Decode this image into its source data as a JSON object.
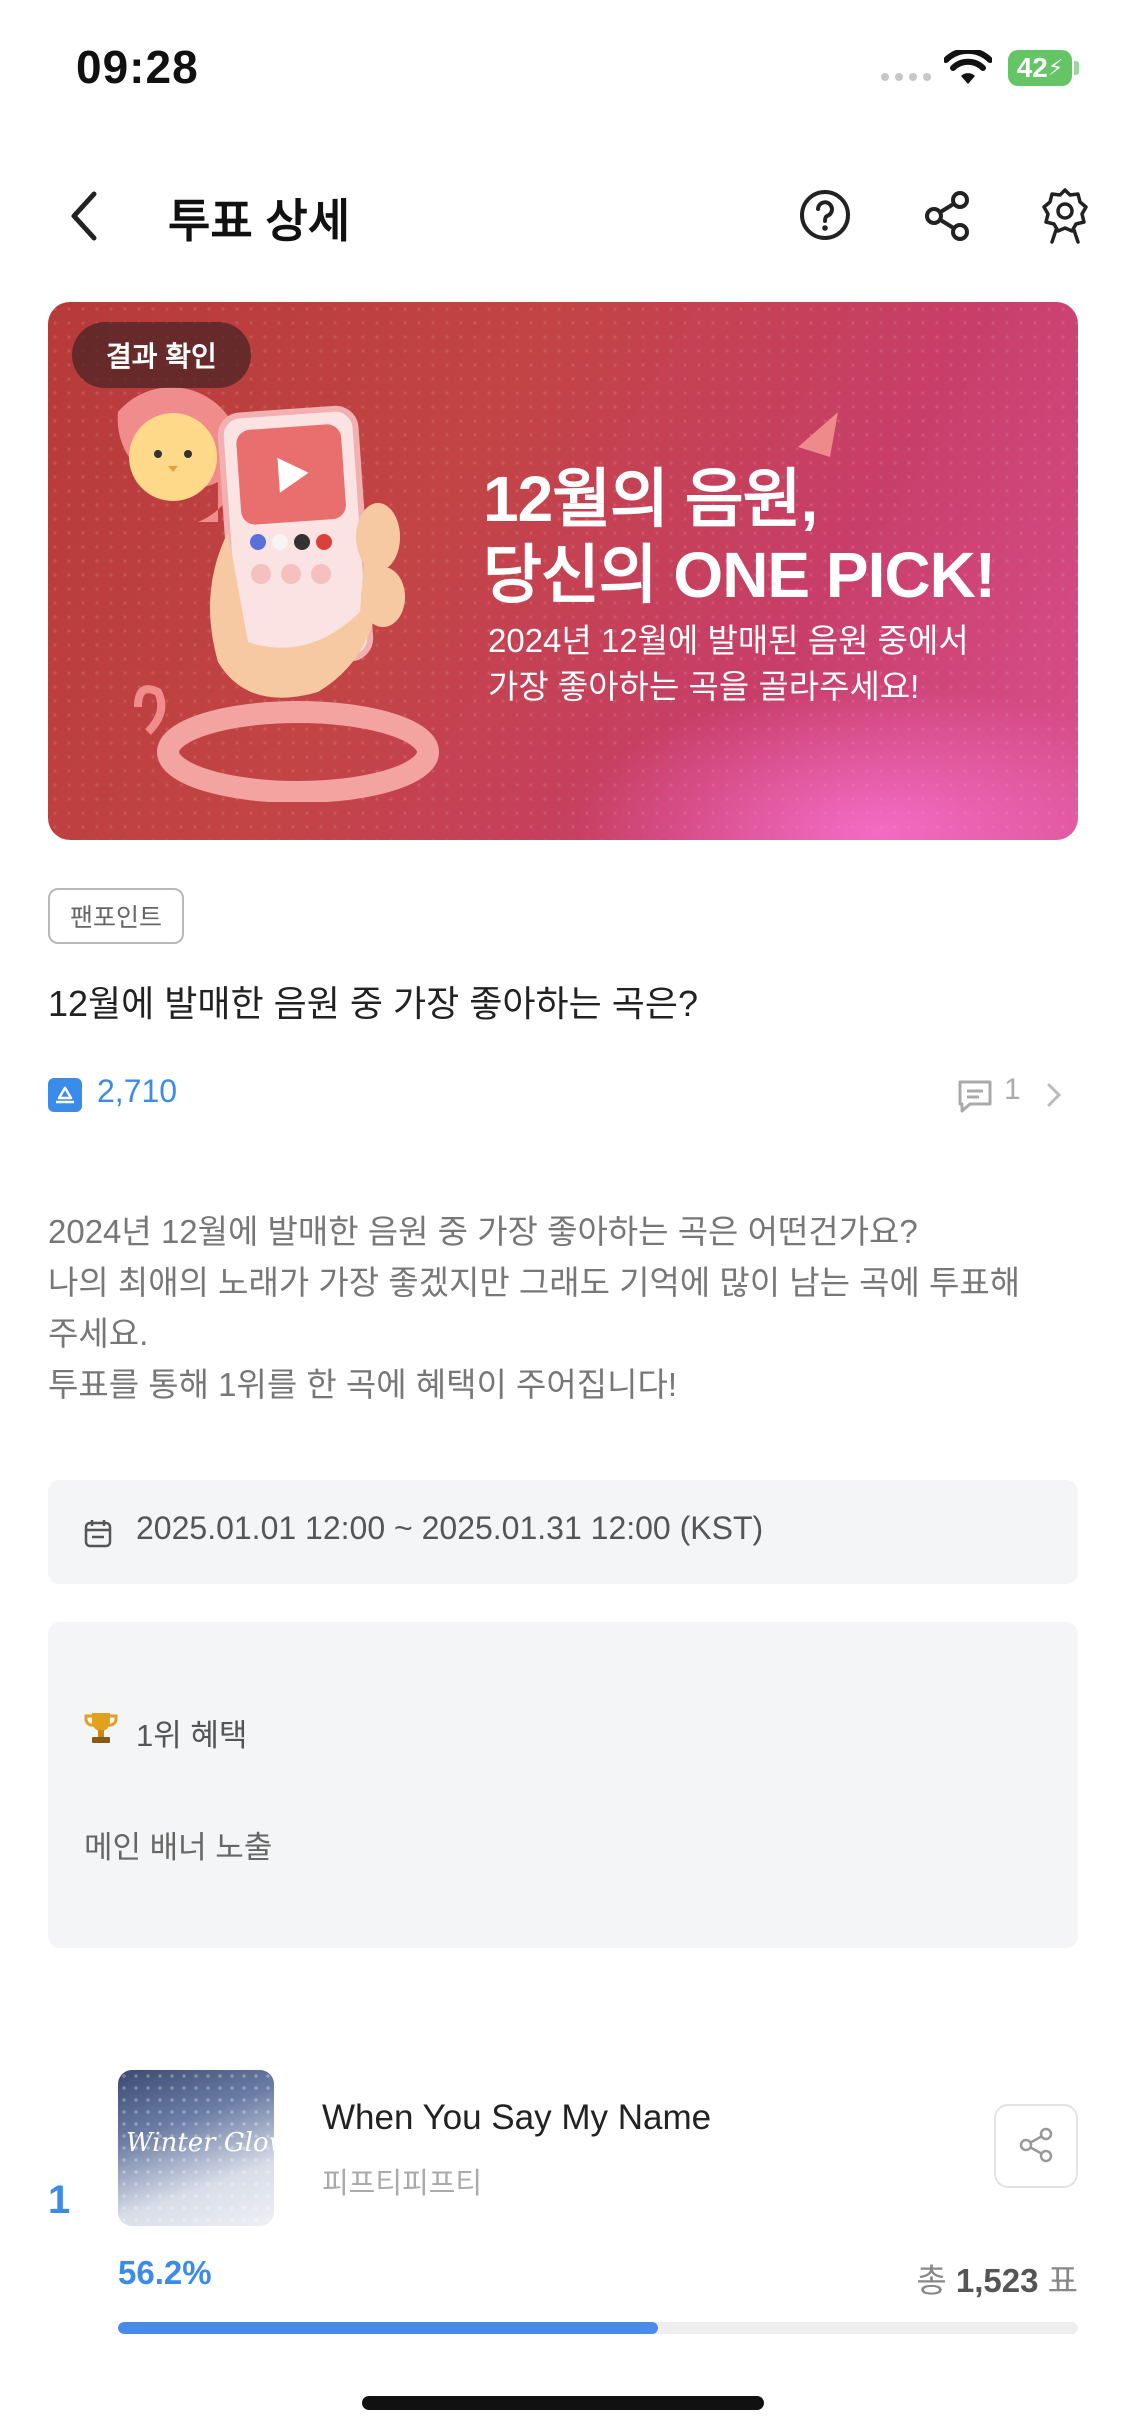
{
  "status_bar": {
    "time": "09:28",
    "battery": "42"
  },
  "header": {
    "title": "투표 상세",
    "icons": [
      "back-icon",
      "help-icon",
      "share-icon",
      "settings-badge-icon"
    ]
  },
  "banner": {
    "badge": "결과 확인",
    "headline_1": "12월의 음원,",
    "headline_2": "당신의 ONE PICK!",
    "sub_1": "2024년 12월에 발매된 음원 중에서",
    "sub_2": "가장 좋아하는 곡을 골라주세요!",
    "colors": {
      "base": "#c24444",
      "accent": "#d9508e"
    }
  },
  "vote": {
    "category": "팬포인트",
    "title": "12월에 발매한 음원 중 가장 좋아하는 곡은?",
    "participants": "2,710",
    "comments": "1",
    "description": [
      "2024년 12월에 발매한 음원 중 가장 좋아하는 곡은 어떤건가요?",
      "나의 최애의 노래가 가장 좋겠지만 그래도 기억에 많이 남는 곡에 투표해",
      "주세요.",
      "투표를 통해 1위를 한 곡에 혜택이 주어집니다!"
    ],
    "period": "2025.01.01 12:00 ~ 2025.01.31 12:00 (KST)",
    "benefit_title": "1위 혜택",
    "benefit_desc": "메인 배너 노출"
  },
  "ranking": [
    {
      "rank": "1",
      "album_text": "Winter Glow",
      "title": "When You Say My Name",
      "artist": "피프티피프티",
      "percent_label": "56.2%",
      "percent": 56.2,
      "total_prefix": "총",
      "votes": "1,523",
      "unit": "표"
    }
  ],
  "colors": {
    "accent": "#3b8bea",
    "bar": "#4a8be8"
  }
}
